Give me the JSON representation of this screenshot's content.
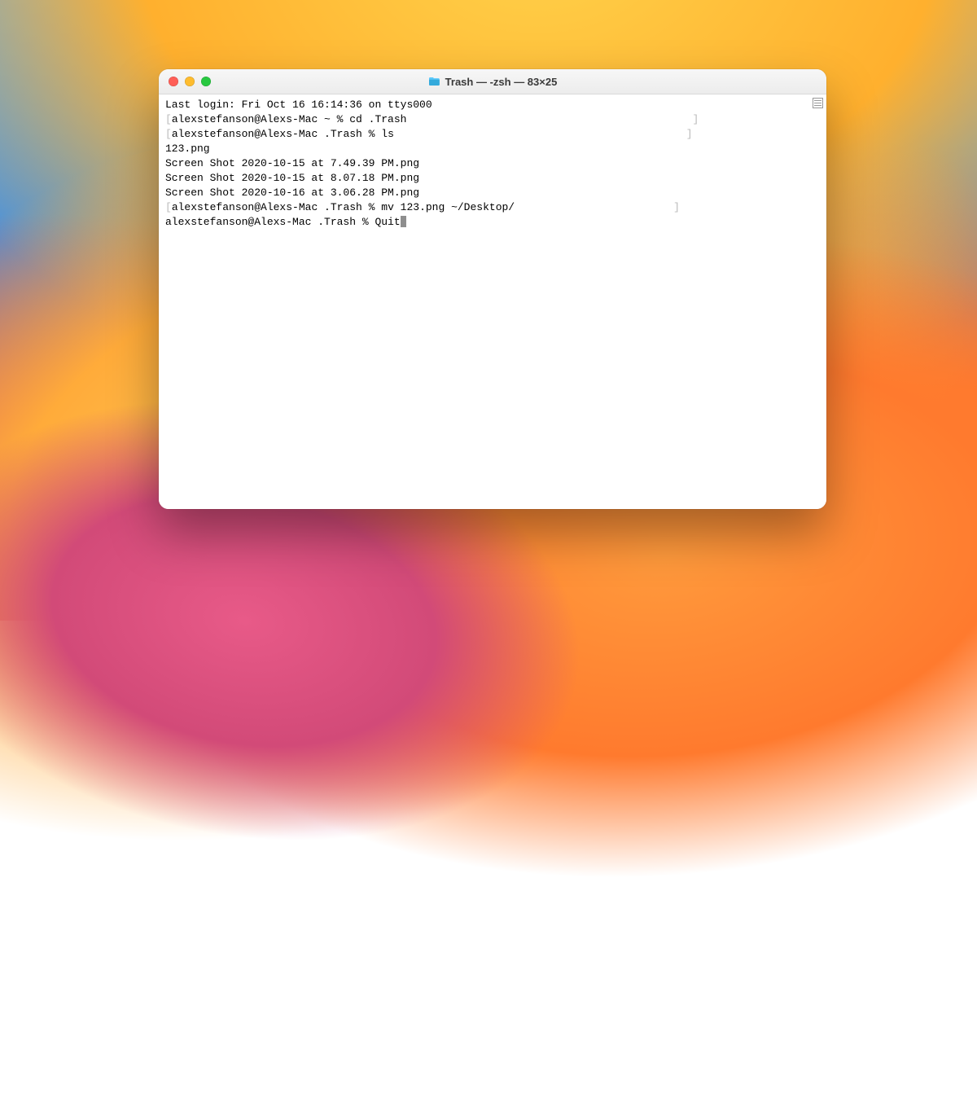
{
  "window": {
    "title": "Trash — -zsh — 83×25"
  },
  "terminal": {
    "last_login": "Last login: Fri Oct 16 16:14:36 on ttys000",
    "prompt1": "alexstefanson@Alexs-Mac ~ % ",
    "cmd1": "cd .Trash",
    "prompt2": "alexstefanson@Alexs-Mac .Trash % ",
    "cmd2": "ls",
    "ls_output": [
      "123.png",
      "Screen Shot 2020-10-15 at 7.49.39 PM.png",
      "Screen Shot 2020-10-15 at 8.07.18 PM.png",
      "Screen Shot 2020-10-16 at 3.06.28 PM.png"
    ],
    "prompt3": "alexstefanson@Alexs-Mac .Trash % ",
    "cmd3": "mv 123.png ~/Desktop/",
    "prompt4": "alexstefanson@Alexs-Mac .Trash % ",
    "cmd4": "Quit"
  }
}
